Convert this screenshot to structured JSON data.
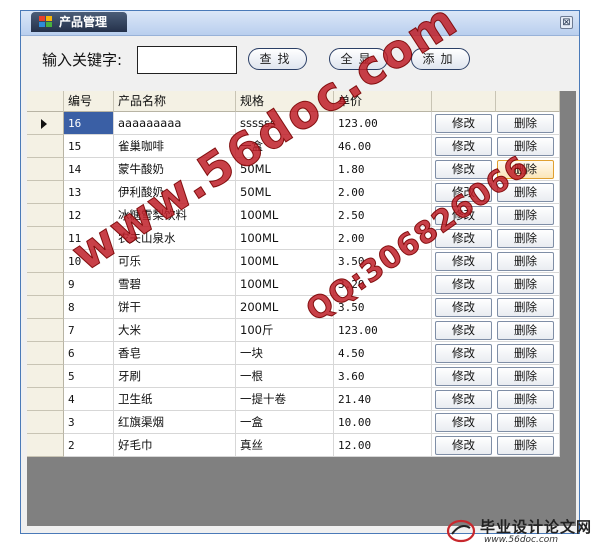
{
  "window": {
    "title": "产品管理",
    "close_glyph": "⊠"
  },
  "toolbar": {
    "keyword_label": "输入关键字:",
    "keyword_value": "",
    "search_label": "查找",
    "show_all_label": "全显",
    "add_label": "添加"
  },
  "table": {
    "columns": [
      "编号",
      "产品名称",
      "规格",
      "单价"
    ],
    "edit_label": "修改",
    "delete_label": "删除",
    "rows": [
      {
        "id": "16",
        "name": "aaaaaaaaa",
        "spec": "ssssss",
        "price": "123.00"
      },
      {
        "id": "15",
        "name": "雀巢咖啡",
        "spec": "一盒",
        "price": "46.00"
      },
      {
        "id": "14",
        "name": "蒙牛酸奶",
        "spec": "50ML",
        "price": "1.80"
      },
      {
        "id": "13",
        "name": "伊利酸奶",
        "spec": "50ML",
        "price": "2.00"
      },
      {
        "id": "12",
        "name": "冰糖雪梨饮料",
        "spec": "100ML",
        "price": "2.50"
      },
      {
        "id": "11",
        "name": "农夫山泉水",
        "spec": "100ML",
        "price": "2.00"
      },
      {
        "id": "10",
        "name": "可乐",
        "spec": "100ML",
        "price": "3.50"
      },
      {
        "id": "9",
        "name": "雪碧",
        "spec": "100ML",
        "price": "3.20"
      },
      {
        "id": "8",
        "name": "饼干",
        "spec": "200ML",
        "price": "3.50"
      },
      {
        "id": "7",
        "name": "大米",
        "spec": "100斤",
        "price": "123.00"
      },
      {
        "id": "6",
        "name": "香皂",
        "spec": "一块",
        "price": "4.50"
      },
      {
        "id": "5",
        "name": "牙刷",
        "spec": "一根",
        "price": "3.60"
      },
      {
        "id": "4",
        "name": "卫生纸",
        "spec": "一提十卷",
        "price": "21.40"
      },
      {
        "id": "3",
        "name": "红旗渠烟",
        "spec": "一盒",
        "price": "10.00"
      },
      {
        "id": "2",
        "name": "好毛巾",
        "spec": "真丝",
        "price": "12.00"
      }
    ]
  },
  "watermark": {
    "site": "www.56doc.com",
    "qq": "QQ:306826066",
    "logo_text": "毕业设计论文网",
    "logo_url": "www.56doc.com"
  },
  "colors": {
    "selection": "#3a5fa5",
    "grid_background": "#808080",
    "header_background": "#f4f1e4",
    "watermark": "#be1e28"
  }
}
